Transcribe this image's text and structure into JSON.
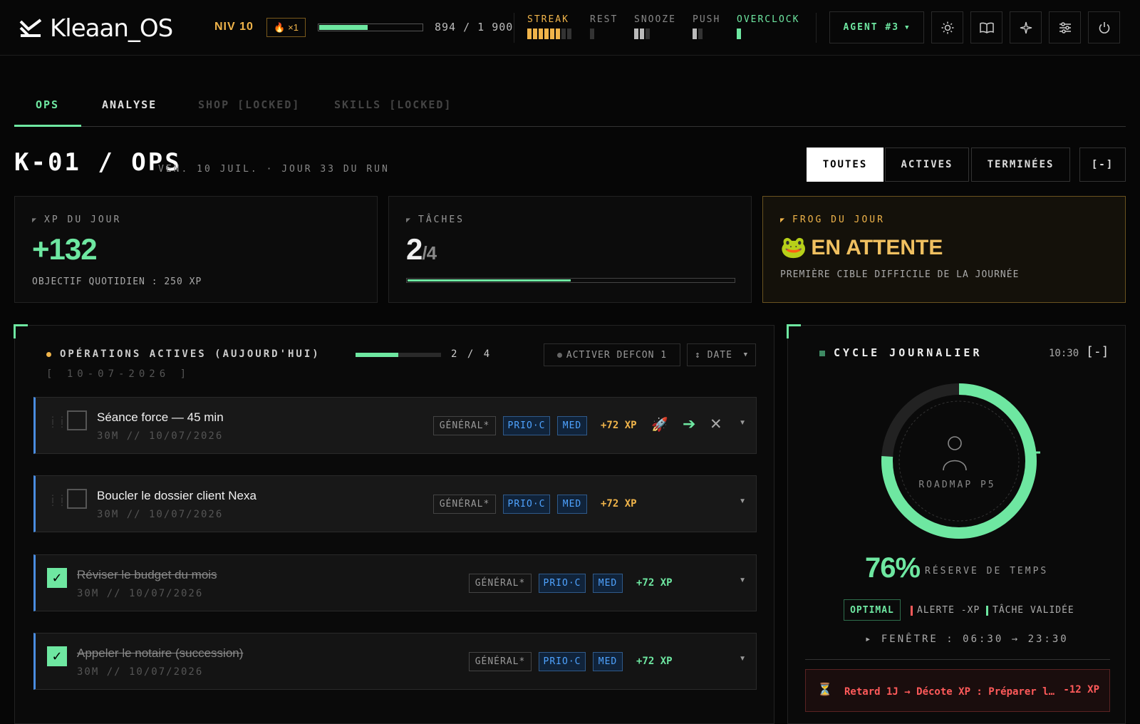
{
  "app": {
    "name": "Kleaan_OS",
    "level": "NIV 10",
    "multiplier": "×1",
    "xp_text": "894 / 1 900",
    "xp_progress": 0.47
  },
  "stats": [
    {
      "label": "STREAK",
      "color": "#f0b44a",
      "filled": 6,
      "total": 8
    },
    {
      "label": "REST",
      "color": "#888888",
      "filled": 0,
      "total": 1
    },
    {
      "label": "SNOOZE",
      "color": "#888888",
      "filled": 2,
      "total": 3
    },
    {
      "label": "PUSH",
      "color": "#888888",
      "filled": 1,
      "total": 2
    },
    {
      "label": "OVERCLOCK",
      "color": "#6ee7a1",
      "filled": 1,
      "total": 1
    }
  ],
  "agent": {
    "label": "AGENT #3"
  },
  "icons": [
    "sun-icon",
    "book-icon",
    "sparkle-icon",
    "sliders-icon",
    "power-icon"
  ],
  "tabs": [
    {
      "label": "OPS",
      "state": "active"
    },
    {
      "label": "ANALYSE",
      "state": "normal"
    },
    {
      "label": "SHOP [LOCKED]",
      "state": "locked"
    },
    {
      "label": "SKILLS [LOCKED]",
      "state": "locked"
    }
  ],
  "page": {
    "title": "K-01 / OPS",
    "subtitle": "VEN. 10 JUIL. · JOUR 33 DU RUN"
  },
  "filters": {
    "all": "TOUTES",
    "active": "ACTIVES",
    "done": "TERMINÉES",
    "collapse": "[-]"
  },
  "cards": {
    "xp": {
      "label": "XP DU JOUR",
      "value": "+132",
      "sub": "OBJECTIF QUOTIDIEN : 250 XP"
    },
    "tasks": {
      "label": "TÂCHES",
      "done": "2",
      "total": "/4",
      "progress": 0.5
    },
    "frog": {
      "label": "FROG DU JOUR",
      "emoji": "🐸",
      "value": "EN ATTENTE",
      "sub": "PREMIÈRE CIBLE DIFFICILE DE LA JOURNÉE"
    }
  },
  "ops": {
    "title": "OPÉRATIONS ACTIVES (AUJOURD'HUI)",
    "date": "[ 10-07-2026 ]",
    "count": "2 / 4",
    "progress": 0.5,
    "defcon": "ACTIVER DEFCON 1",
    "sort": "↕ DATE"
  },
  "tasks": [
    {
      "title": "Séance force — 45 min",
      "meta": "30M // 10/07/2026",
      "tag": "GÉNÉRAL*",
      "prio": "PRIO·C",
      "level": "MED",
      "xp": "+72 XP",
      "done": false,
      "emoji": "🚀",
      "arrow": "➔",
      "close": "✕"
    },
    {
      "title": "Boucler le dossier client Nexa",
      "meta": "30M // 10/07/2026",
      "tag": "GÉNÉRAL*",
      "prio": "PRIO·C",
      "level": "MED",
      "xp": "+72 XP",
      "done": false
    },
    {
      "title": "Réviser le budget du mois",
      "meta": "30M // 10/07/2026",
      "tag": "GÉNÉRAL*",
      "prio": "PRIO·C",
      "level": "MED",
      "xp": "+72 XP",
      "done": true
    },
    {
      "title": "Appeler le notaire (succession)",
      "meta": "30M // 10/07/2026",
      "tag": "GÉNÉRAL*",
      "prio": "PRIO·C",
      "level": "MED",
      "xp": "+72 XP",
      "done": true
    }
  ],
  "cycle": {
    "title": "CYCLE JOURNALIER",
    "time": "10:30",
    "collapse": "[-]",
    "center_label": "ROADMAP P5",
    "percent": "76%",
    "percent_value": 0.76,
    "percent_label": "RÉSERVE DE TEMPS",
    "optimal": "OPTIMAL",
    "legend_alert": "ALERTE -XP",
    "legend_done": "TÂCHE VALIDÉE",
    "window": "▸ FENÊTRE : 06:30 → 23:30",
    "alert_text": "Retard 1J → Décote XP : Préparer l…",
    "alert_xp": "-12 XP",
    "alert_icon": "⏳"
  },
  "colors": {
    "accent": "#6ee7a1",
    "gold": "#f0b44a",
    "blue": "#4fa3ff",
    "danger": "#ff5a5a"
  }
}
